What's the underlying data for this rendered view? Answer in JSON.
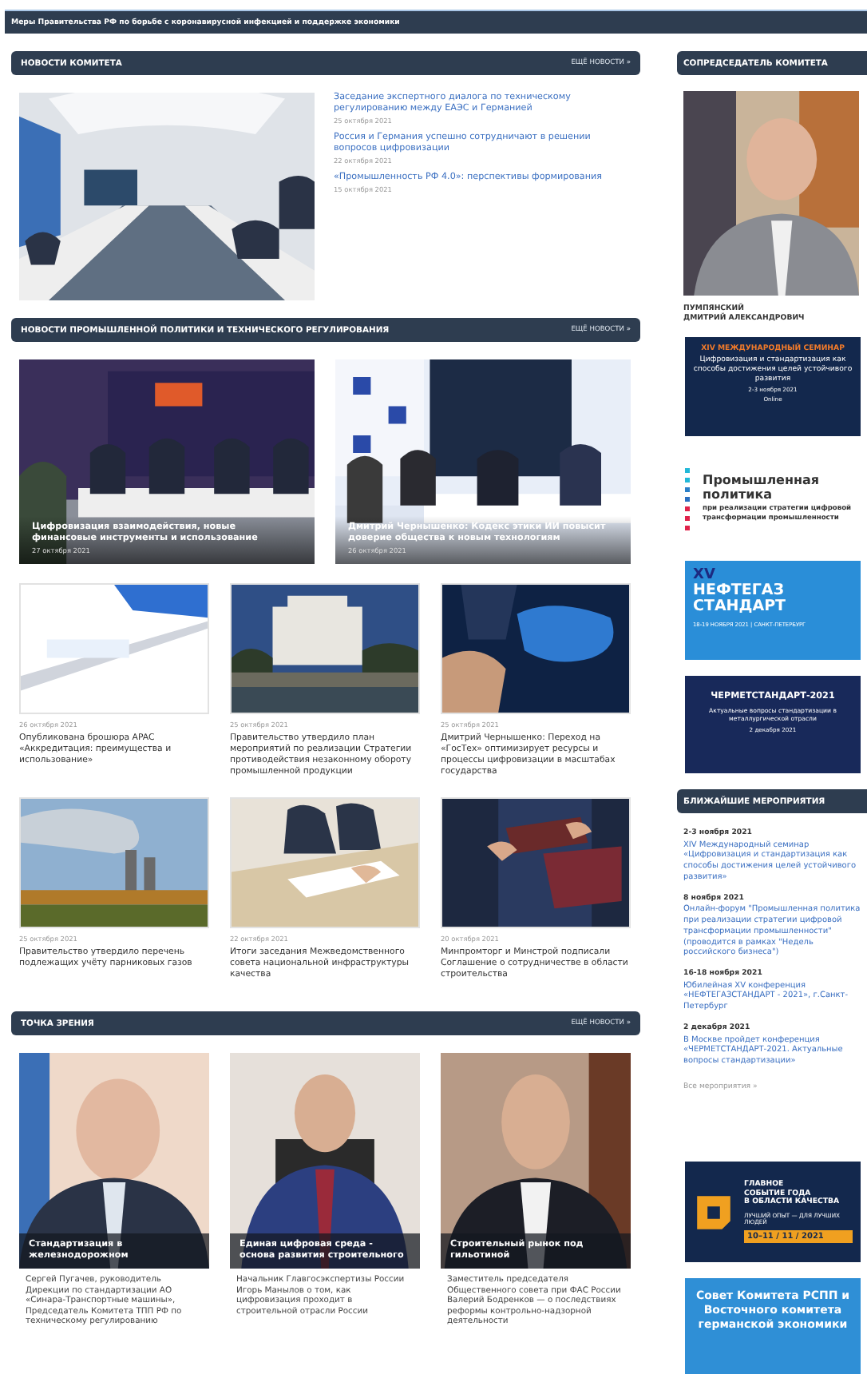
{
  "top_bar": {
    "text": "Меры Правительства РФ по борьбе с коронавирусной инфекцией и поддержке экономики"
  },
  "committee_news": {
    "title": "НОВОСТИ КОМИТЕТА",
    "more": "ЕЩЁ НОВОСТИ »",
    "items": [
      {
        "title": "Заседание экспертного диалога по техническому регулированию между ЕАЭС и Германией",
        "date": "25 октября 2021"
      },
      {
        "title": "Россия и Германия успешно сотрудничают в решении вопросов цифровизации",
        "date": "22 октября 2021"
      },
      {
        "title": "«Промышленность РФ 4.0»: перспективы формирования",
        "date": "15 октября 2021"
      }
    ]
  },
  "industry_news": {
    "title": "НОВОСТИ ПРОМЫШЛЕННОЙ ПОЛИТИКИ И ТЕХНИЧЕСКОГО РЕГУЛИРОВАНИЯ",
    "more": "ЕЩЁ НОВОСТИ »",
    "featured": [
      {
        "title": "Цифровизация взаимодействия, новые финансовые инструменты и использование",
        "date": "27 октября 2021"
      },
      {
        "title": "Дмитрий Чернышенко: Кодекс этики ИИ повысит доверие общества к новым технологиям",
        "date": "26 октября 2021"
      }
    ],
    "items": [
      {
        "date": "26 октября 2021",
        "title": "Опубликована брошюра APAC «Аккредитация: преимущества и использование»"
      },
      {
        "date": "25 октября 2021",
        "title": "Правительство утвердило план мероприятий по реализации Стратегии противодействия незаконному обороту промышленной продукции"
      },
      {
        "date": "25 октября 2021",
        "title": "Дмитрий Чернышенко: Переход на «ГосТех» оптимизирует ресурсы и процессы цифровизации в масштабах государства"
      },
      {
        "date": "25 октября 2021",
        "title": "Правительство утвердило перечень подлежащих учёту парниковых газов"
      },
      {
        "date": "22 октября 2021",
        "title": "Итоги заседания Межведомственного совета национальной инфраструктуры качества"
      },
      {
        "date": "20 октября 2021",
        "title": "Минпромторг и Минстрой подписали Соглашение о сотрудничестве в области строительства"
      }
    ]
  },
  "viewpoint": {
    "title": "ТОЧКА ЗРЕНИЯ",
    "more": "ЕЩЁ НОВОСТИ »",
    "items": [
      {
        "overlay": "Стандартизация в железнодорожном",
        "caption": "Сергей Пугачев, руководитель Дирекции по стандартизации АО «Синара-Транспортные машины», Председатель Комитета ТПП РФ по техническому регулированию"
      },
      {
        "overlay": "Единая цифровая среда - основа развития строительного",
        "caption": "Начальник Главгосэкспертизы России Игорь Манылов о том, как цифровизация проходит в строительной отрасли России"
      },
      {
        "overlay": "Строительный рынок под гильотиной",
        "caption": "Заместитель председателя Общественного совета при ФАС России Валерий Бодренков — о последствиях реформы контрольно-надзорной деятельности"
      }
    ]
  },
  "sidebar": {
    "cochair": {
      "title": "СОПРЕДСЕДАТЕЛЬ КОМИТЕТА",
      "name_lines": [
        "ПУМПЯНСКИЙ",
        "ДМИТРИЙ АЛЕКСАНДРОВИЧ"
      ]
    },
    "banners": [
      {
        "kind": "seminar",
        "heading": "XIV МЕЖДУНАРОДНЫЙ СЕМИНАР",
        "title": "Цифровизация и стандартизация как способы достижения целей устойчивого развития",
        "date": "2-3 ноября 2021",
        "note": "Online"
      },
      {
        "kind": "policy",
        "title": "Промышленная политика",
        "subtitle": "при реализации стратегии цифровой трансформации промышленности",
        "dots": [
          {
            "color": "#22b8d8"
          },
          {
            "color": "#22b8d8"
          },
          {
            "color": "#2a7fc8"
          },
          {
            "color": "#2a6fc0"
          },
          {
            "color": "#e0224a"
          },
          {
            "color": "#e0224a"
          },
          {
            "color": "#e0224a"
          }
        ]
      },
      {
        "kind": "neftegaz",
        "numeral": "XV",
        "title_lines": [
          "НЕФТЕГАЗ",
          "СТАНДАРТ"
        ],
        "footer": "18-19 НОЯБРЯ 2021 | САНКТ-ПЕТЕРБУРГ"
      },
      {
        "kind": "chermet",
        "title": "ЧЕРМЕТСТАНДАРТ-2021",
        "subtitle": "Актуальные вопросы стандартизации в металлургической отрасли",
        "date": "2 декабря 2021"
      }
    ],
    "events": {
      "title": "БЛИЖАЙШИЕ МЕРОПРИЯТИЯ",
      "items": [
        {
          "date": "2-3 ноября 2021",
          "text": "XIV Международный семинар «Цифровизация и стандартизация как способы достижения целей устойчивого развития»"
        },
        {
          "date": "8 ноября 2021",
          "text": "Онлайн-форум \"Промышленная политика при реализации стратегии цифровой трансформации промышленности\" (проводится в рамках \"Недель российского бизнеса\")"
        },
        {
          "date": "16-18 ноября 2021",
          "text": "Юбилейная XV конференция «НЕФТЕГАЗСТАНДАРТ - 2021», г.Санкт-Петербург"
        },
        {
          "date": "2 декабря 2021",
          "text": "В Москве пройдет конференция «ЧЕРМЕТСТАНДАРТ-2021. Актуальные вопросы стандартизации»"
        }
      ],
      "all_link": "Все мероприятия »"
    },
    "bottom_banners": [
      {
        "kind": "quality",
        "lines": [
          "ГЛАВНОЕ",
          "СОБЫТИЕ ГОДА",
          "В ОБЛАСТИ КАЧЕСТВА"
        ],
        "tagline": "ЛУЧШИЙ ОПЫТ — ДЛЯ ЛУЧШИХ ЛЮДЕЙ",
        "date": "10–11 / 11 / 2021"
      },
      {
        "kind": "council",
        "text": "Совет Комитета РСПП и Восточного комитета германской экономики"
      }
    ]
  }
}
